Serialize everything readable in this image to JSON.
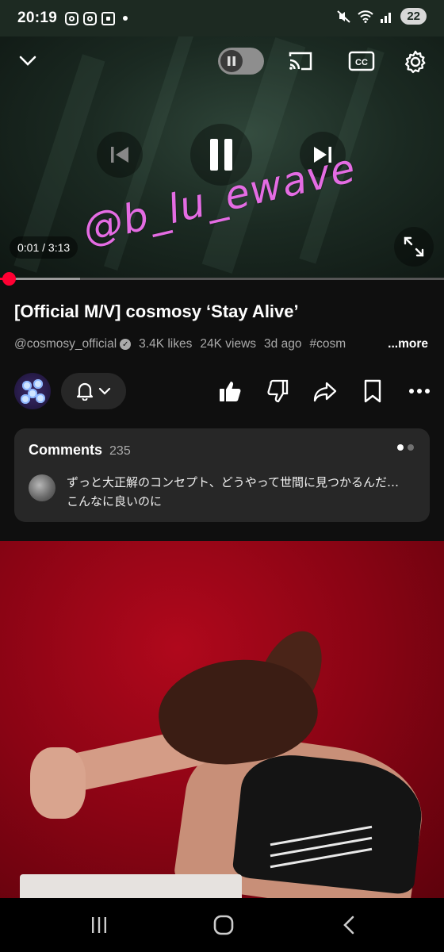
{
  "status_bar": {
    "time": "20:19",
    "battery": "22"
  },
  "player": {
    "time_position": "0:01 / 3:13",
    "progress_fraction": 0.0052,
    "buffered_fraction": 0.18,
    "state": "playing",
    "watermark": "@b_lu_ewave"
  },
  "video": {
    "title": "[Official M/V] cosmosy ‘Stay Alive’",
    "channel": "@cosmosy_official",
    "likes": "3.4K likes",
    "views": "24K views",
    "age": "3d ago",
    "hashtag": "#cosm",
    "more_label": "...more"
  },
  "comments": {
    "label": "Comments",
    "count": "235",
    "top_comment": "ずっと大正解のコンセプト、どうやって世間に見つかるんだ…こんなに良いのに"
  },
  "colors": {
    "accent": "#ff0033",
    "watermark": "#e46ce3",
    "card_bg": "#272727",
    "meta_text": "#aaaaaa"
  },
  "icons": [
    "collapse-chevron-icon",
    "autoplay-toggle-icon",
    "cast-icon",
    "captions-icon",
    "settings-gear-icon",
    "previous-icon",
    "pause-icon",
    "next-icon",
    "fullscreen-icon",
    "verified-icon",
    "bell-icon",
    "chevron-down-icon",
    "like-icon",
    "dislike-icon",
    "share-icon",
    "save-icon",
    "more-options-icon",
    "recents-icon",
    "home-icon",
    "back-icon"
  ]
}
